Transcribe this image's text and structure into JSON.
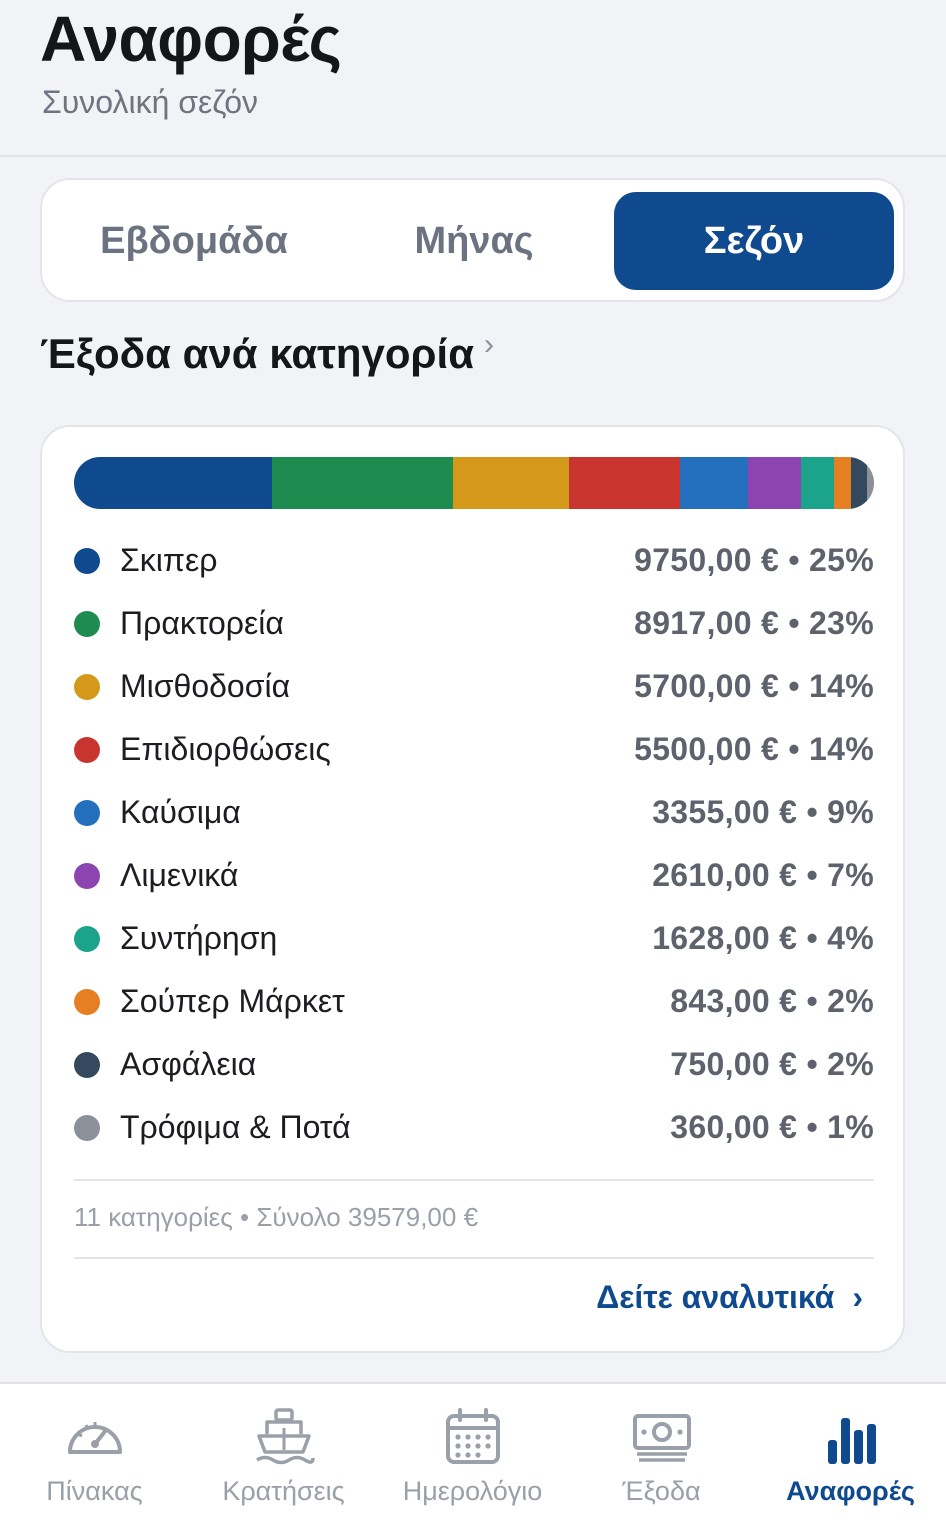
{
  "header": {
    "title": "Αναφορές",
    "subtitle": "Συνολική σεζόν"
  },
  "segments": [
    {
      "label": "Εβδομάδα",
      "active": false
    },
    {
      "label": "Μήνας",
      "active": false
    },
    {
      "label": "Σεζόν",
      "active": true
    }
  ],
  "section": {
    "title": "Έξοδα ανά κατηγορία",
    "chevron": "›"
  },
  "chart_data": {
    "type": "bar",
    "title": "",
    "categories": [
      "Σκιπερ",
      "Πρακτορεία",
      "Μισθοδοσία",
      "Επιδιορθώσεις",
      "Καύσιμα",
      "Λιμενικά",
      "Συντήρηση",
      "Σούπερ Μάρκετ",
      "Ασφάλεια",
      "Τρόφιμα & Ποτά"
    ],
    "values": [
      9750,
      8917,
      5700,
      5500,
      3355,
      2610,
      1628,
      843,
      750,
      360
    ],
    "percents": [
      "25%",
      "23%",
      "14%",
      "14%",
      "9%",
      "7%",
      "4%",
      "2%",
      "2%",
      "1%"
    ],
    "amounts": [
      "9750,00 €",
      "8917,00 €",
      "5700,00 €",
      "5500,00 €",
      "3355,00 €",
      "2610,00 €",
      "1628,00 €",
      "843,00 €",
      "750,00 €",
      "360,00 €"
    ],
    "colors": [
      "#0f4a8f",
      "#1e8c4e",
      "#d4991b",
      "#c8352e",
      "#2470bf",
      "#8c44b0",
      "#1ba38b",
      "#e67e22",
      "#34495e",
      "#8a9199"
    ],
    "total": 39579
  },
  "summary": {
    "text": "11 κατηγορίες • Σύνολο 39579,00 €"
  },
  "details_link": {
    "label": "Δείτε αναλυτικά",
    "chevron": "›"
  },
  "tabbar": [
    {
      "label": "Πίνακας",
      "icon": "gauge-icon",
      "active": false
    },
    {
      "label": "Κρατήσεις",
      "icon": "boat-icon",
      "active": false
    },
    {
      "label": "Ημερολόγιο",
      "icon": "calendar-icon",
      "active": false
    },
    {
      "label": "Έξοδα",
      "icon": "banknote-icon",
      "active": false
    },
    {
      "label": "Αναφορές",
      "icon": "bar-chart-icon",
      "active": true
    }
  ]
}
